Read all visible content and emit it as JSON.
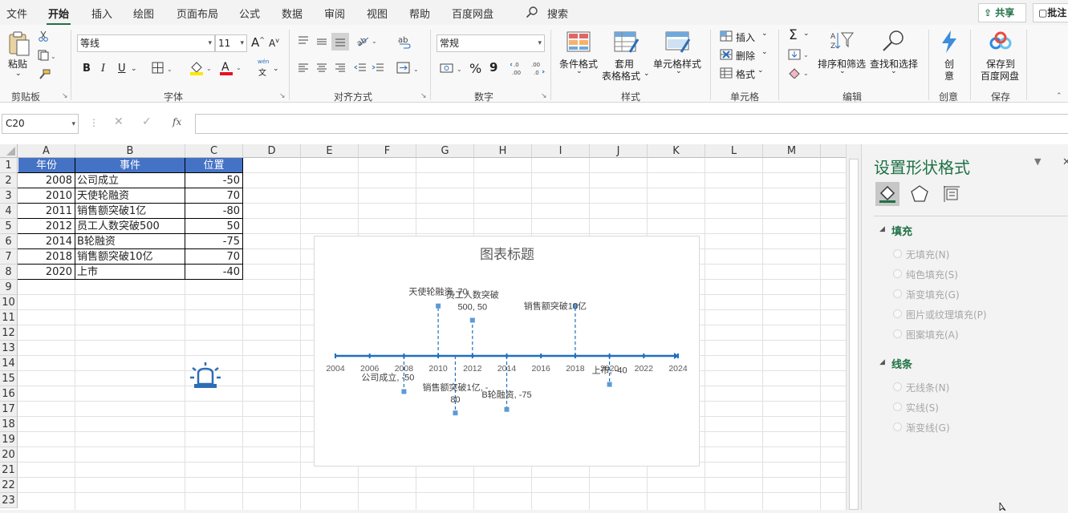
{
  "menu": [
    "文件",
    "开始",
    "插入",
    "绘图",
    "页面布局",
    "公式",
    "数据",
    "审阅",
    "视图",
    "帮助",
    "百度网盘"
  ],
  "search_label": "搜索",
  "share_label": "共享",
  "comment_label": "批注",
  "ribbon": {
    "clipboard": {
      "paste": "粘贴",
      "group": "剪贴板"
    },
    "font": {
      "name": "等线",
      "size": "11",
      "bold": "B",
      "italic": "I",
      "underline": "U",
      "wen": "wén",
      "wen2": "文",
      "grow": "A",
      "shrink": "A",
      "group": "字体"
    },
    "align": {
      "group": "对齐方式"
    },
    "number": {
      "format": "常规",
      "percent": "%",
      "comma": "9",
      "group": "数字"
    },
    "styles": {
      "conditional": "条件格式",
      "table1": "套用",
      "table2": "表格格式",
      "cell": "单元格样式",
      "group": "样式"
    },
    "cells": {
      "insert": "插入",
      "delete": "删除",
      "format": "格式",
      "group": "单元格"
    },
    "edit": {
      "sum": "Σ",
      "sort": "排序和筛选",
      "find": "查找和选择",
      "group": "编辑"
    },
    "create": {
      "l1": "创",
      "l2": "意",
      "group": "创意"
    },
    "save": {
      "l1": "保存到",
      "l2": "百度网盘",
      "group": "保存"
    }
  },
  "namebox": "C20",
  "fx": "fx",
  "columns": [
    "A",
    "B",
    "C",
    "D",
    "E",
    "F",
    "G",
    "H",
    "I",
    "J",
    "K",
    "L",
    "M"
  ],
  "rows": [
    "1",
    "2",
    "3",
    "4",
    "5",
    "6",
    "7",
    "8",
    "9",
    "10",
    "11",
    "12",
    "13",
    "14",
    "15",
    "16",
    "17",
    "18",
    "19",
    "20",
    "21",
    "22",
    "23"
  ],
  "table": {
    "headers": [
      "年份",
      "事件",
      "位置"
    ],
    "rows": [
      [
        "2008",
        "公司成立",
        "-50"
      ],
      [
        "2010",
        "天使轮融资",
        "70"
      ],
      [
        "2011",
        "销售额突破1亿",
        "-80"
      ],
      [
        "2012",
        "员工人数突破500",
        "50"
      ],
      [
        "2014",
        "B轮融资",
        "-75"
      ],
      [
        "2018",
        "销售额突破10亿",
        "70"
      ],
      [
        "2020",
        "上市",
        "-40"
      ]
    ]
  },
  "chart_data": {
    "type": "scatter",
    "title": "图表标题",
    "x_ticks": [
      "2004",
      "2006",
      "2008",
      "2010",
      "2012",
      "2014",
      "2016",
      "2018",
      "2020",
      "2022",
      "2024"
    ],
    "xlim": [
      2004,
      2024
    ],
    "points": [
      {
        "x": 2008,
        "y": -50,
        "label1": "公司成立, -50",
        "label2": ""
      },
      {
        "x": 2010,
        "y": 70,
        "label1": "天使轮融资, 70",
        "label2": ""
      },
      {
        "x": 2011,
        "y": -80,
        "label1": "销售额突破1亿, -",
        "label2": "80"
      },
      {
        "x": 2012,
        "y": 50,
        "label1": "员工人数突破",
        "label2": "500, 50"
      },
      {
        "x": 2014,
        "y": -75,
        "label1": "B轮融资, -75",
        "label2": ""
      },
      {
        "x": 2018,
        "y": 70,
        "label1": "销售额突破10亿",
        "label2": ""
      },
      {
        "x": 2020,
        "y": -40,
        "label1": "上市, -40",
        "label2": ""
      }
    ],
    "colors": {
      "axis": "#1f6fbf",
      "point": "#5b9bd5"
    }
  },
  "pane": {
    "title": "设置形状格式",
    "fill_section": "填充",
    "fill_options": [
      "无填充(N)",
      "纯色填充(S)",
      "渐变填充(G)",
      "图片或纹理填充(P)",
      "图案填充(A)"
    ],
    "line_section": "线条",
    "line_options": [
      "无线条(N)",
      "实线(S)",
      "渐变线(G)"
    ]
  }
}
